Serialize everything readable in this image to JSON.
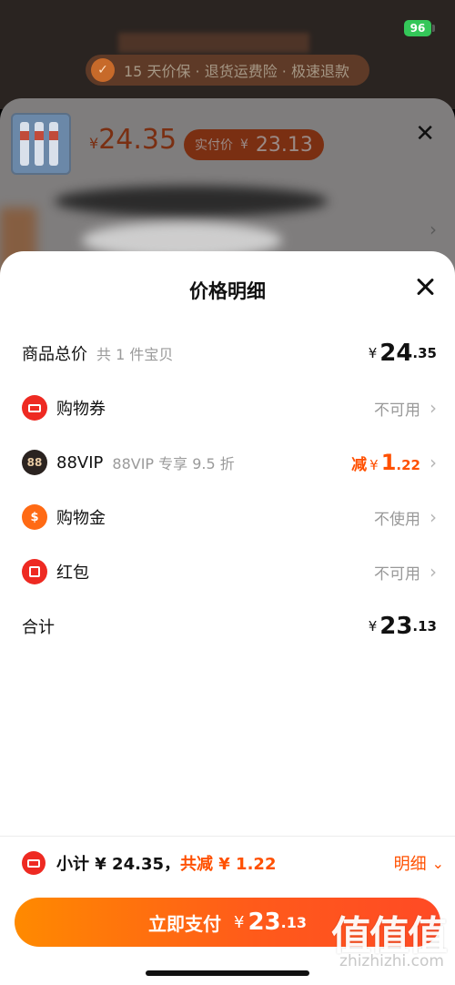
{
  "status_bar": {
    "battery": "96"
  },
  "background": {
    "guarantee_text": "15 天价保 · 退货运费险 · 极速退款",
    "product_price_symbol": "¥",
    "product_price": "24.35",
    "paid_label": "实付价",
    "paid_symbol": "¥",
    "paid_amount": "23.13"
  },
  "panel": {
    "title": "价格明细",
    "rows": [
      {
        "label": "商品总价",
        "sub": "共 1 件宝贝",
        "currency": "¥",
        "int": "24",
        "dec": ".35"
      },
      {
        "label": "购物券",
        "status": "不可用"
      },
      {
        "label": "88VIP",
        "sub": "88VIP 专享 9.5 折",
        "prefix": "减",
        "currency": "¥",
        "int": "1",
        "dec": ".22",
        "icon_text": "88"
      },
      {
        "label": "购物金",
        "status": "不使用"
      },
      {
        "label": "红包",
        "status": "不可用"
      },
      {
        "label": "合计",
        "currency": "¥",
        "int": "23",
        "dec": ".13"
      }
    ]
  },
  "footer": {
    "subtotal": "小计 ¥ 24.35，",
    "reduced": "共减 ¥ 1.22",
    "detail": "明细"
  },
  "pay_button": {
    "label": "立即支付",
    "currency": "¥",
    "int": "23",
    "dec": ".13"
  },
  "watermark": {
    "logo": "值值值",
    "url": "zhizhizhi.com"
  },
  "colors": {
    "accent": "#ff5000",
    "coupon_red": "#ee2a22",
    "vip_dark": "#2b2320"
  },
  "icons": [
    "close-icon",
    "shield-icon",
    "coupon-icon",
    "vip-88-icon",
    "gold-icon",
    "red-packet-icon",
    "chevron-right-icon",
    "chevron-down-icon"
  ]
}
